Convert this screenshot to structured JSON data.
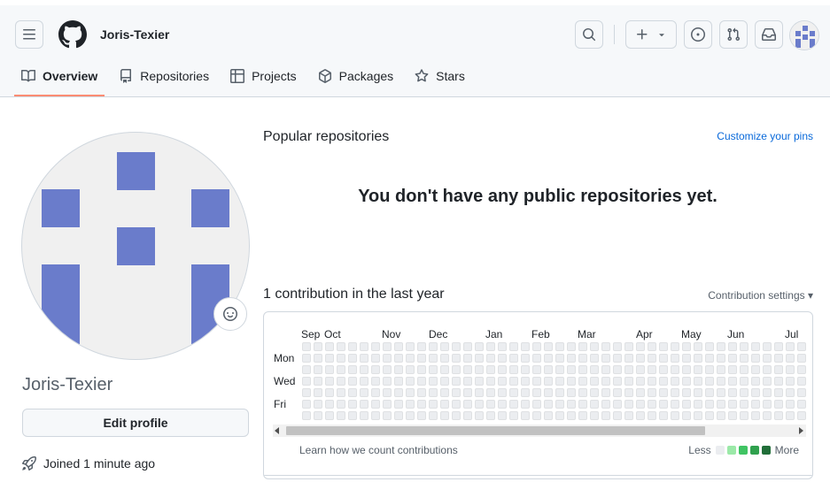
{
  "header": {
    "username": "Joris-Texier",
    "icons": [
      "hamburger-icon",
      "github-logo-icon",
      "search-icon",
      "plus-icon",
      "issues-icon",
      "pull-request-icon",
      "inbox-icon"
    ]
  },
  "tabs": [
    {
      "label": "Overview",
      "icon": "book-icon",
      "active": true
    },
    {
      "label": "Repositories",
      "icon": "repo-icon",
      "active": false
    },
    {
      "label": "Projects",
      "icon": "table-icon",
      "active": false
    },
    {
      "label": "Packages",
      "icon": "package-icon",
      "active": false
    },
    {
      "label": "Stars",
      "icon": "star-icon",
      "active": false
    }
  ],
  "profile": {
    "name": "Joris-Texier",
    "edit_label": "Edit profile",
    "joined": "Joined 1 minute ago"
  },
  "popular": {
    "title": "Popular repositories",
    "customize": "Customize your pins",
    "empty": "You don't have any public repositories yet."
  },
  "contributions": {
    "title": "1 contribution in the last year",
    "settings": "Contribution settings ▾",
    "months": [
      "Sep",
      "Oct",
      "Nov",
      "Dec",
      "Jan",
      "Feb",
      "Mar",
      "Apr",
      "May",
      "Jun",
      "Jul"
    ],
    "days": [
      "Mon",
      "Wed",
      "Fri"
    ],
    "learn": "Learn how we count contributions",
    "less": "Less",
    "more": "More",
    "legend_colors": [
      "#ebedf0",
      "#9be9a8",
      "#40c463",
      "#30a14e",
      "#216e39"
    ],
    "empty_color": "#ebedf0"
  },
  "colors": {
    "accent_tab": "#fd8c73",
    "link": "#0969da",
    "avatar_blue": "#6a7ccb"
  }
}
